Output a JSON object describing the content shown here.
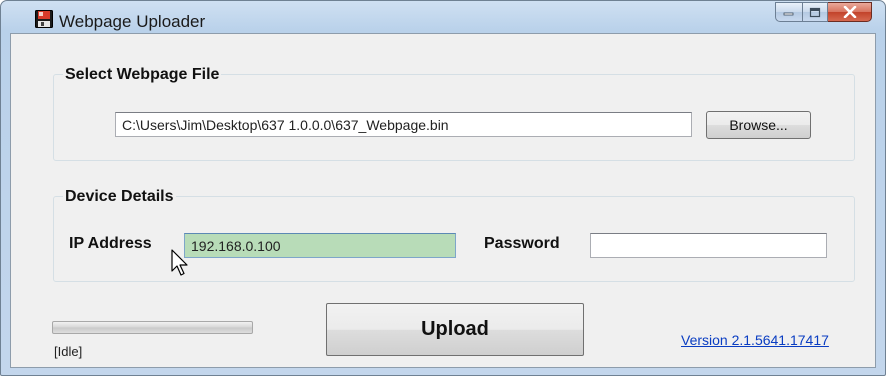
{
  "window": {
    "title": "Webpage Uploader"
  },
  "icons": {
    "app": "app-floppy-icon",
    "minimize": "minimize-icon",
    "maximize": "maximize-icon",
    "close": "close-icon",
    "cursor": "mouse-pointer-icon"
  },
  "colors": {
    "ip_field_highlight": "#b8dcb8",
    "link": "#0a3dc2",
    "close_button": "#c2432b",
    "titlebar": "#b9d1ea"
  },
  "file_group": {
    "title": "Select Webpage File",
    "file_path": "C:\\Users\\Jim\\Desktop\\637 1.0.0.0\\637_Webpage.bin",
    "browse_label": "Browse..."
  },
  "device_group": {
    "title": "Device Details",
    "ip_label": "IP Address",
    "ip_value": "192.168.0.100",
    "password_label": "Password",
    "password_value": ""
  },
  "footer": {
    "progress": 0,
    "status": "[Idle]",
    "upload_label": "Upload",
    "version_link": "Version 2.1.5641.17417"
  }
}
